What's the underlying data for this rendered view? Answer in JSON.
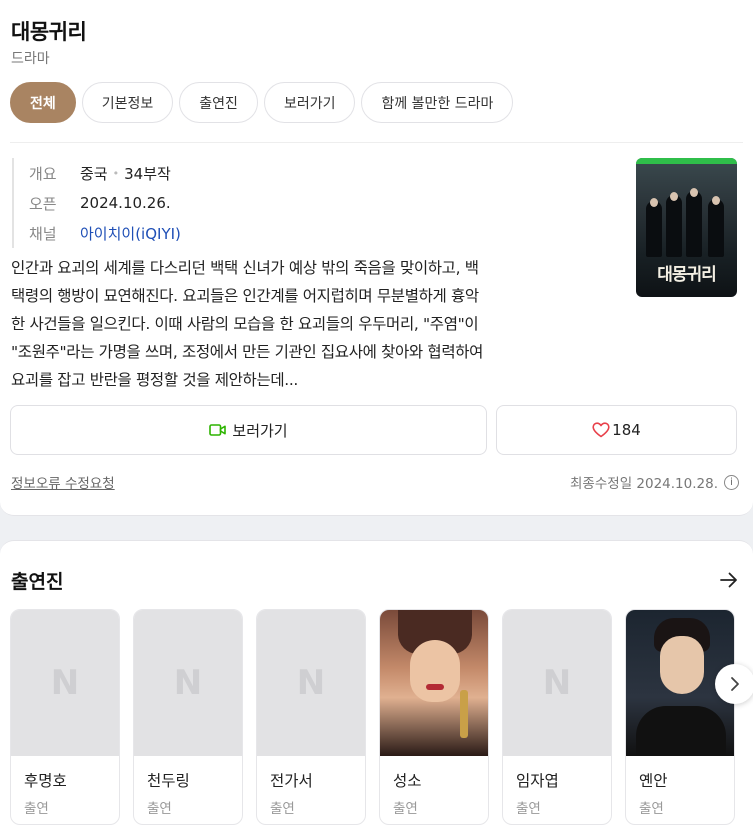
{
  "header": {
    "title": "대몽귀리",
    "genre": "드라마"
  },
  "tabs": [
    {
      "label": "전체",
      "active": true
    },
    {
      "label": "기본정보"
    },
    {
      "label": "출연진"
    },
    {
      "label": "보러가기"
    },
    {
      "label": "함께 볼만한 드라마"
    }
  ],
  "info": {
    "overview_label": "개요",
    "country": "중국",
    "episodes": "34부작",
    "open_label": "오픈",
    "open_date": "2024.10.26.",
    "channel_label": "채널",
    "channel": "아이치이(iQIYI)"
  },
  "poster": {
    "title": "대몽귀리"
  },
  "synopsis_lines": [
    "인간과 요괴의 세계를 다스리던 백택 신녀가 예상 밖의 죽음을 맞이하고, 백",
    "택령의 행방이 묘연해진다. 요괴들은 인간계를 어지럽히며 무분별하게 흉악",
    "한 사건들을 일으킨다. 이때 사람의 모습을 한 요괴들의 우두머리, \"주염\"이",
    "\"조원주\"라는 가명을 쓰며, 조정에서 만든 기관인 집요사에 찾아와 협력하여",
    "요괴를 잡고 반란을 평정할 것을 제안하는데..."
  ],
  "actions": {
    "watch_label": "보러가기",
    "like_count": "184"
  },
  "footer": {
    "report_label": "정보오류 수정요청",
    "updated": "최종수정일 2024.10.28."
  },
  "cast_section": {
    "title": "출연진",
    "members": [
      {
        "name": "후명호",
        "role": "출연"
      },
      {
        "name": "천두링",
        "role": "출연"
      },
      {
        "name": "전가서",
        "role": "출연"
      },
      {
        "name": "성소",
        "role": "출연"
      },
      {
        "name": "임자엽",
        "role": "출연"
      },
      {
        "name": "옌안",
        "role": "출연"
      }
    ]
  },
  "colors": {
    "accent": "#a98462",
    "link": "#1f4fb6",
    "watch_icon": "#2db400",
    "heart": "#e8404a"
  },
  "icons": [
    "video-camera-icon",
    "heart-icon",
    "info-icon",
    "arrow-right-icon",
    "chevron-right-icon"
  ]
}
